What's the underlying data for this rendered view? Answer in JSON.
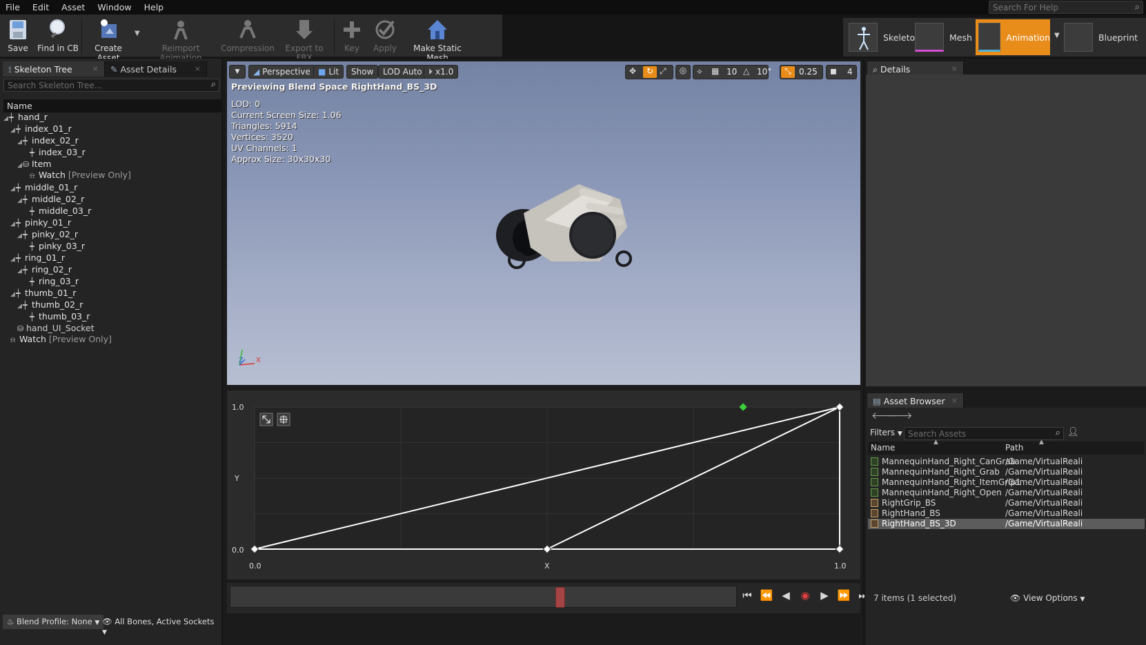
{
  "menu": [
    "File",
    "Edit",
    "Asset",
    "Window",
    "Help"
  ],
  "help_search_placeholder": "Search For Help",
  "toolbar": {
    "save": "Save",
    "find_in_cb": "Find in CB",
    "create_asset": "Create Asset",
    "reimport_animation": "Reimport Animation",
    "compression": "Compression",
    "export_to_fbx": "Export to FBX",
    "key": "Key",
    "apply": "Apply",
    "make_static_mesh": "Make Static Mesh"
  },
  "modes": {
    "skeleton": "Skeleton",
    "mesh": "Mesh",
    "animation": "Animation",
    "blueprint": "Blueprint",
    "active": "animation",
    "accent_color": "#e88c1a"
  },
  "left_tabs": {
    "skeleton_tree": "Skeleton Tree",
    "asset_details": "Asset Details"
  },
  "skeleton_search_placeholder": "Search Skeleton Tree...",
  "tree_header": "Name",
  "tree": [
    {
      "label": "hand_r",
      "suffix": ""
    },
    {
      "label": "index_01_r",
      "suffix": ""
    },
    {
      "label": "index_02_r",
      "suffix": ""
    },
    {
      "label": "index_03_r",
      "suffix": ""
    },
    {
      "label": "Item",
      "suffix": ""
    },
    {
      "label": "Watch",
      "suffix": "[Preview Only]"
    },
    {
      "label": "middle_01_r",
      "suffix": ""
    },
    {
      "label": "middle_02_r",
      "suffix": ""
    },
    {
      "label": "middle_03_r",
      "suffix": ""
    },
    {
      "label": "pinky_01_r",
      "suffix": ""
    },
    {
      "label": "pinky_02_r",
      "suffix": ""
    },
    {
      "label": "pinky_03_r",
      "suffix": ""
    },
    {
      "label": "ring_01_r",
      "suffix": ""
    },
    {
      "label": "ring_02_r",
      "suffix": ""
    },
    {
      "label": "ring_03_r",
      "suffix": ""
    },
    {
      "label": "thumb_01_r",
      "suffix": ""
    },
    {
      "label": "thumb_02_r",
      "suffix": ""
    },
    {
      "label": "thumb_03_r",
      "suffix": ""
    },
    {
      "label": "hand_UI_Socket",
      "suffix": ""
    },
    {
      "label": "Watch",
      "suffix": "[Preview Only]"
    }
  ],
  "bottom_bar": {
    "blend_profile": "Blend Profile: None",
    "bones_filter": "All Bones, Active Sockets"
  },
  "viewport": {
    "perspective": "Perspective",
    "lit": "Lit",
    "show": "Show",
    "lod": "LOD Auto",
    "speed": "x1.0",
    "grid_size": "10",
    "rotation_snap": "10°",
    "scale_snap": "0.25",
    "camera_speed": "4",
    "title": "Previewing Blend Space RightHand_BS_3D",
    "stats": [
      "LOD: 0",
      "Current Screen Size: 1.06",
      "Triangles: 5914",
      "Vertices: 3520",
      "UV Channels: 1",
      "Approx Size: 30x30x30"
    ],
    "axis_x": "X",
    "axis_z": "Z"
  },
  "blend_graph": {
    "x_label": "X",
    "y_label": "Y",
    "x_min": "0.0",
    "x_max": "1.0",
    "y_min": "0.0",
    "y_max": "1.0",
    "samples": [
      [
        0.0,
        0.0
      ],
      [
        0.5,
        0.0
      ],
      [
        1.0,
        0.0
      ],
      [
        1.0,
        1.0
      ]
    ],
    "preview_point": [
      0.835,
      1.0
    ]
  },
  "details_tab": "Details",
  "asset_browser": {
    "tab": "Asset Browser",
    "filters": "Filters",
    "search_placeholder": "Search Assets",
    "col_name": "Name",
    "col_path": "Path",
    "items": [
      {
        "name": "MannequinHand_Right_CanGrab",
        "path": "/Game/VirtualReali",
        "kind": "anim"
      },
      {
        "name": "MannequinHand_Right_Grab",
        "path": "/Game/VirtualReali",
        "kind": "anim"
      },
      {
        "name": "MannequinHand_Right_ItemGrip1",
        "path": "/Game/VirtualReali",
        "kind": "anim"
      },
      {
        "name": "MannequinHand_Right_Open",
        "path": "/Game/VirtualReali",
        "kind": "anim"
      },
      {
        "name": "RightGrip_BS",
        "path": "/Game/VirtualReali",
        "kind": "bs"
      },
      {
        "name": "RightHand_BS",
        "path": "/Game/VirtualReali",
        "kind": "bs"
      },
      {
        "name": "RightHand_BS_3D",
        "path": "/Game/VirtualReali",
        "kind": "bs"
      }
    ],
    "selected_index": 6,
    "status": "7 items (1 selected)",
    "view_options": "View Options"
  }
}
